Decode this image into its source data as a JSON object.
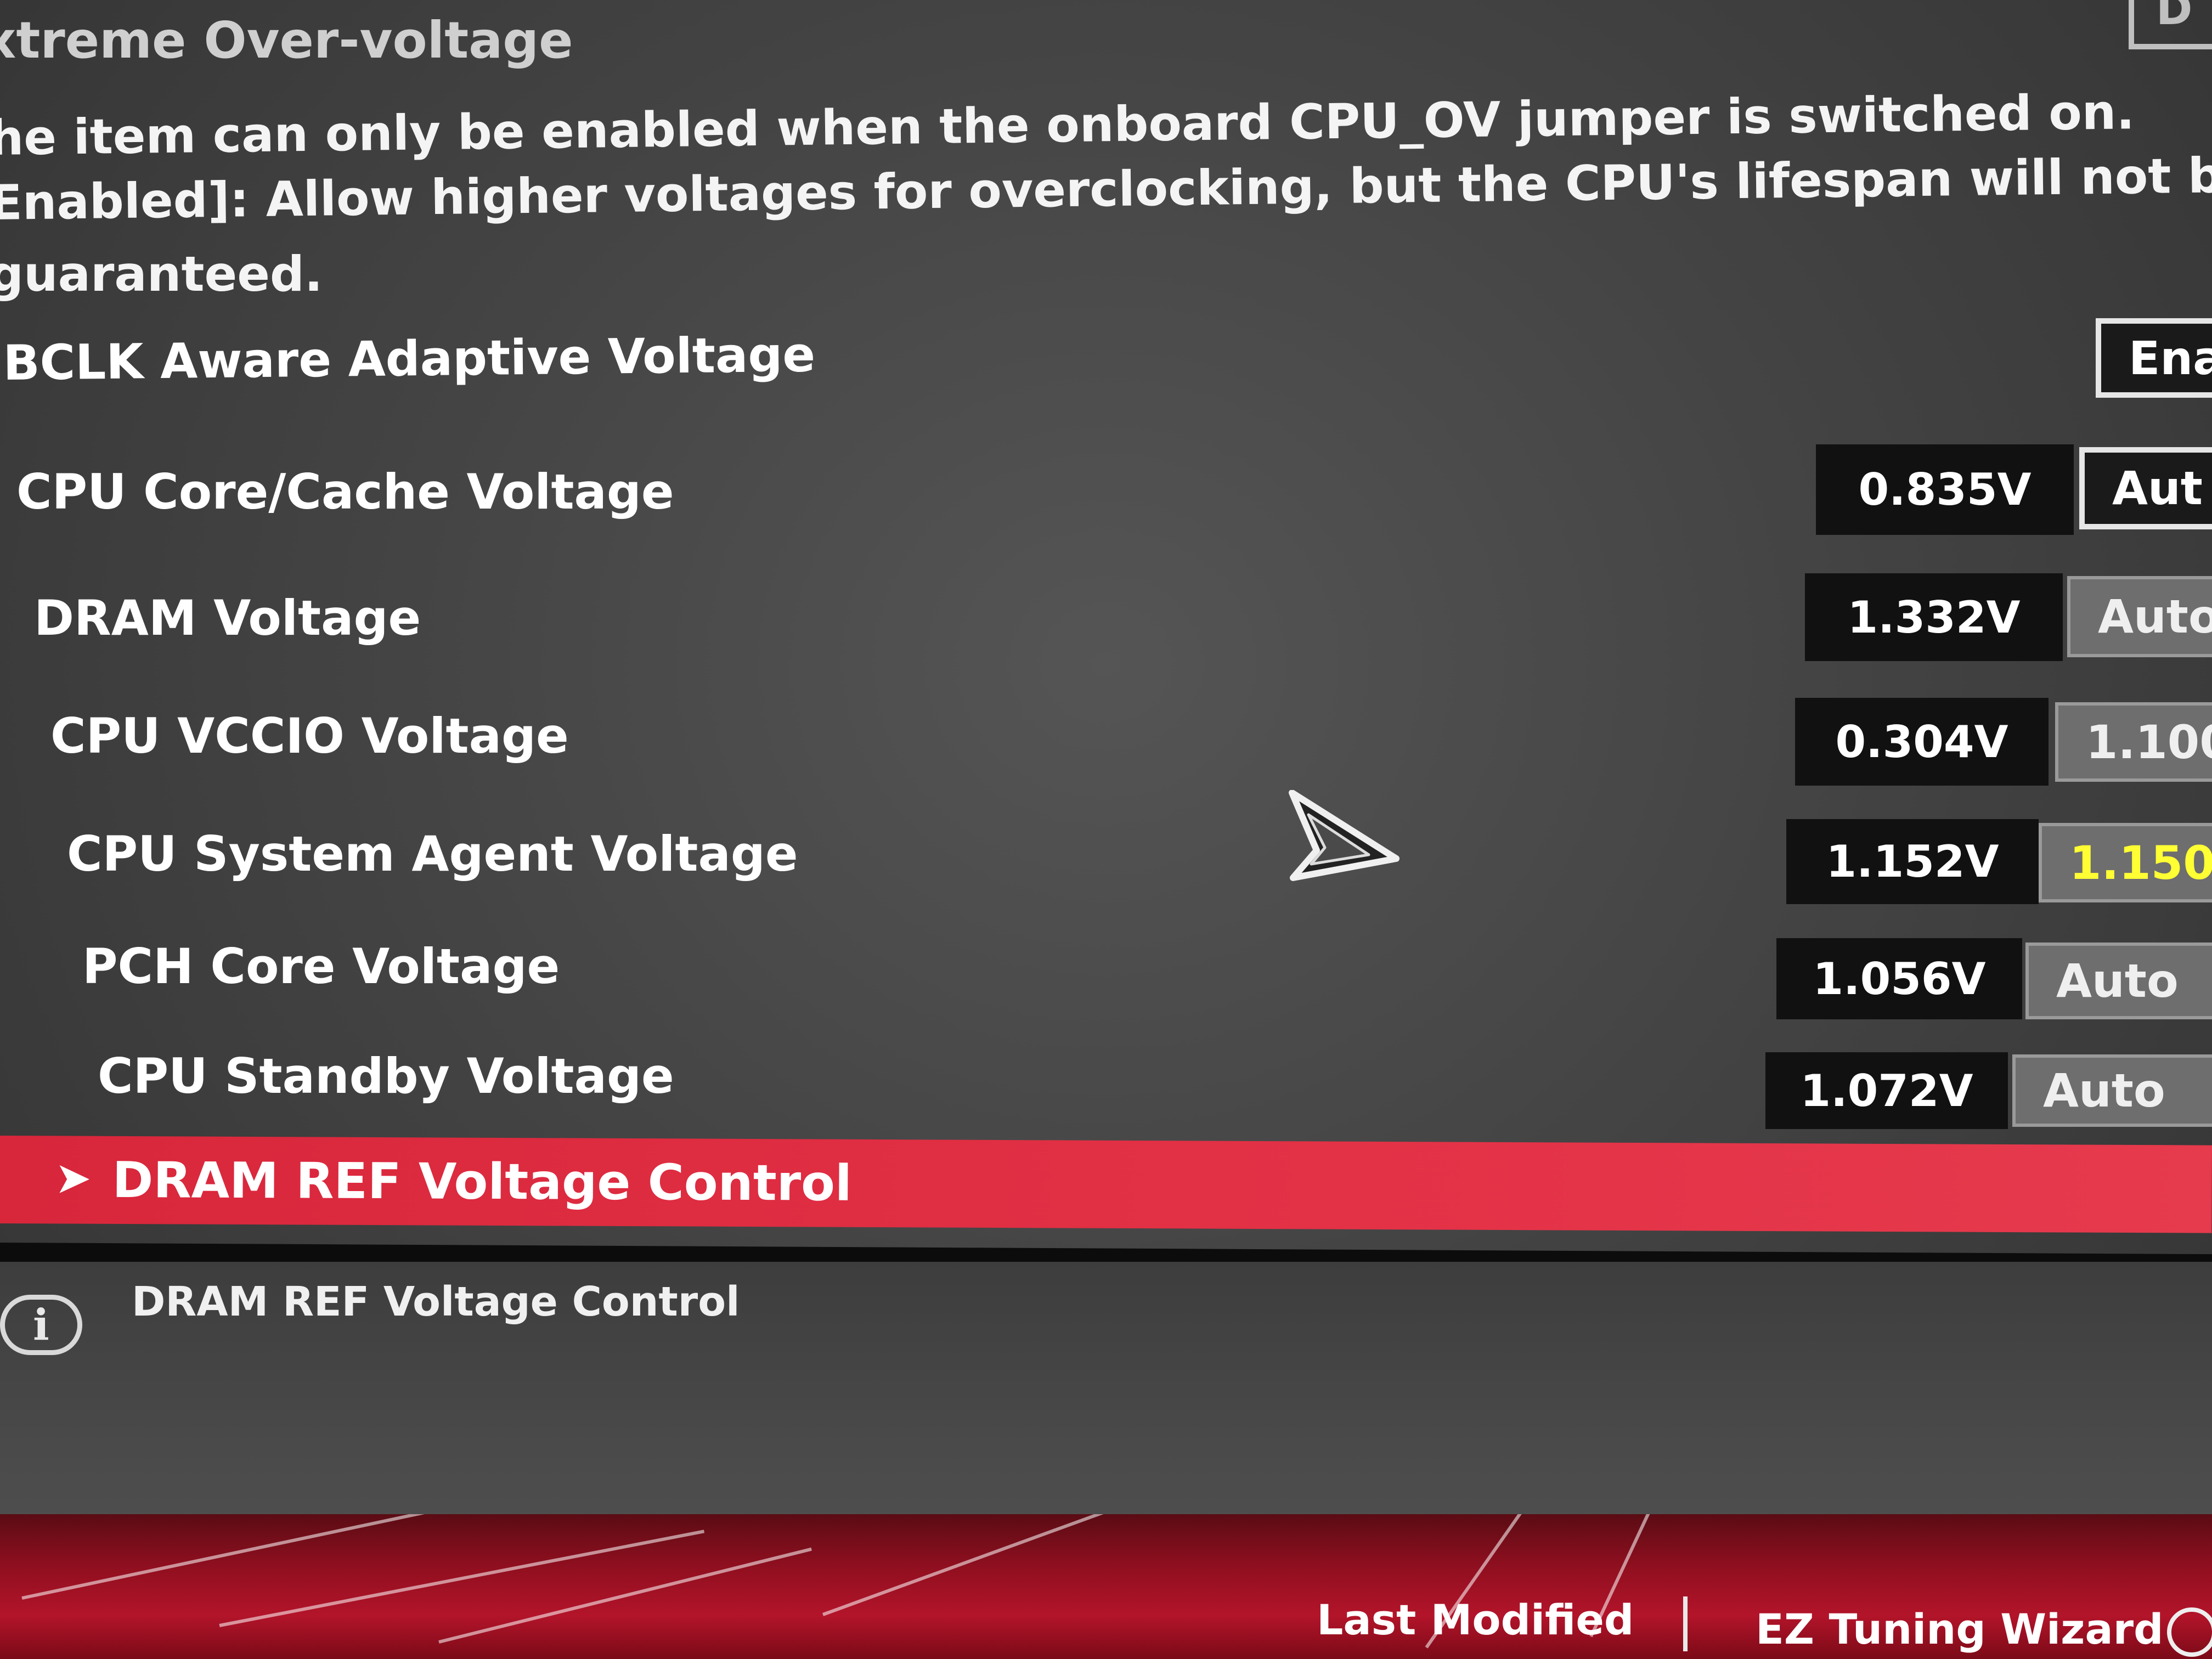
{
  "header": {
    "title": "xtreme Over-voltage",
    "corner_box_letter": "D"
  },
  "description": {
    "line1": "he item can only be enabled when the onboard CPU_OV jumper is switched on.",
    "line2": "Enabled]: Allow higher voltages for overclocking, but the CPU's lifespan will not be",
    "line3": "guaranteed."
  },
  "settings": {
    "bclk": {
      "label": "BCLK Aware Adaptive Voltage",
      "value": "Ena"
    },
    "cpu_core": {
      "label": "CPU Core/Cache Voltage",
      "reading": "0.835V",
      "value": "Aut"
    },
    "dram": {
      "label": "DRAM Voltage",
      "reading": "1.332V",
      "value": "Auto"
    },
    "vccio": {
      "label": "CPU VCCIO Voltage",
      "reading": "0.304V",
      "value": "1.100"
    },
    "system_agent": {
      "label": "CPU System Agent Voltage",
      "reading": "1.152V",
      "value": "1.150"
    },
    "pch_core": {
      "label": "PCH Core Voltage",
      "reading": "1.056V",
      "value": "Auto"
    },
    "cpu_standby": {
      "label": "CPU Standby Voltage",
      "reading": "1.072V",
      "value": "Auto"
    }
  },
  "submenu": {
    "chevron": "➤",
    "label": "DRAM REF Voltage Control"
  },
  "info": {
    "icon_glyph": "i",
    "text": "DRAM REF Voltage Control"
  },
  "footer": {
    "last_modified": "Last Modified",
    "ez_tuning": "EZ Tuning Wizard"
  },
  "icons": {
    "info": "info-icon",
    "cursor": "mouse-pointer-icon",
    "chevron": "chevron-right-icon",
    "wizard": "wizard-icon"
  },
  "colors": {
    "highlight": "#e33146",
    "changed_value": "#ffff33",
    "footer_red": "#b3142a"
  }
}
